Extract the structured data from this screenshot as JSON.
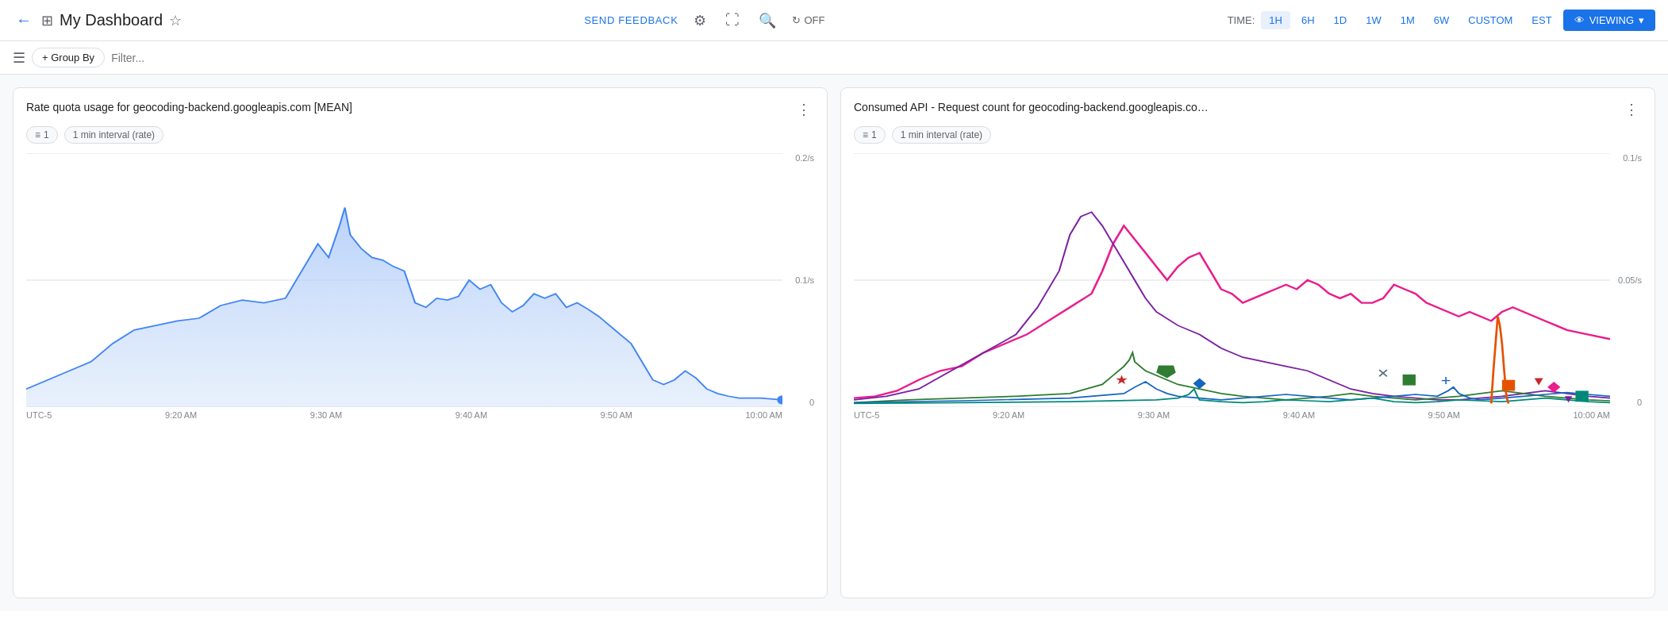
{
  "header": {
    "back_label": "←",
    "dashboard_icon": "⊞",
    "title": "My Dashboard",
    "star_icon": "☆",
    "send_feedback": "SEND FEEDBACK",
    "settings_icon": "⚙",
    "fullscreen_icon": "⛶",
    "search_icon": "🔍",
    "refresh_label": "OFF",
    "time_label": "TIME:",
    "time_options": [
      "1H",
      "6H",
      "1D",
      "1W",
      "1M",
      "6W",
      "CUSTOM"
    ],
    "active_time": "1H",
    "timezone": "EST",
    "viewing_label": "VIEWING",
    "dropdown_arrow": "▾"
  },
  "toolbar": {
    "menu_icon": "☰",
    "group_by_label": "+ Group By",
    "filter_placeholder": "Filter..."
  },
  "charts": [
    {
      "id": "chart1",
      "title": "Rate quota usage for geocoding-backend.googleapis.com [MEAN]",
      "more_icon": "⋮",
      "chip1_icon": "≡",
      "chip1_label": "1",
      "chip2_label": "1 min interval (rate)",
      "y_top": "0.2/s",
      "y_mid": "0.1/s",
      "y_bottom": "0",
      "x_labels": [
        "UTC-5",
        "9:20 AM",
        "9:30 AM",
        "9:40 AM",
        "9:50 AM",
        "10:00 AM"
      ],
      "type": "area"
    },
    {
      "id": "chart2",
      "title": "Consumed API - Request count for geocoding-backend.googleapis.co…",
      "more_icon": "⋮",
      "chip1_icon": "≡",
      "chip1_label": "1",
      "chip2_label": "1 min interval (rate)",
      "y_top": "0.1/s",
      "y_mid": "0.05/s",
      "y_bottom": "0",
      "x_labels": [
        "UTC-5",
        "9:20 AM",
        "9:30 AM",
        "9:40 AM",
        "9:50 AM",
        "10:00 AM"
      ],
      "type": "multiline"
    }
  ]
}
